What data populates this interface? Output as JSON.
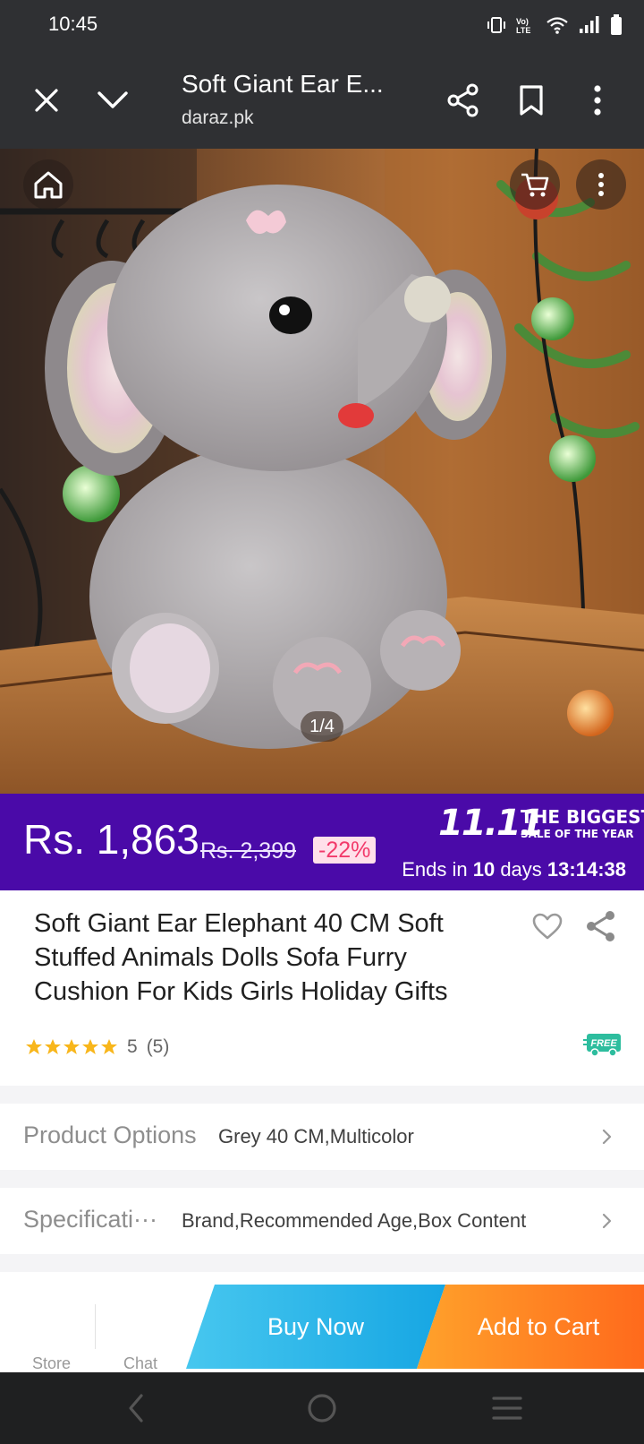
{
  "status_bar": {
    "time": "10:45"
  },
  "toolbar": {
    "title": "Soft Giant Ear E...",
    "url": "daraz.pk"
  },
  "hero": {
    "image_counter": "1/4"
  },
  "price": {
    "current": "Rs. 1,863",
    "original": "Rs. 2,399",
    "discount": "-22%"
  },
  "campaign": {
    "logo_number": "11.11",
    "logo_line1": "THE BIGGEST",
    "logo_line2": "SALE OF THE YEAR",
    "ends_prefix": "Ends in",
    "ends_days": "10",
    "ends_days_label": "days",
    "ends_time": "13:14:38"
  },
  "product": {
    "title": "Soft Giant Ear Elephant 40 CM Soft Stuffed Animals Dolls Sofa Furry Cushion For Kids Girls Holiday Gifts",
    "rating": 5,
    "rating_text": "5",
    "review_count": "(5)",
    "free_shipping_badge": "FREE"
  },
  "options": {
    "product_options_label": "Product Options",
    "product_options_value": "Grey 40 CM,Multicolor",
    "specifications_label": "Specificati···",
    "specifications_value": "Brand,Recommended Age,Box Content"
  },
  "action_bar": {
    "store_label": "Store",
    "chat_label": "Chat",
    "buy_now_label": "Buy Now",
    "add_to_cart_label": "Add to Cart"
  },
  "colors": {
    "banner_purple": "#4a0aa8",
    "discount_pink": "#f23a6b",
    "buy_now_blue": "#16a6e3",
    "add_to_cart_orange": "#ff6a1c",
    "star_yellow": "#f8b61b",
    "free_teal": "#2dbd9e"
  },
  "icons": {
    "close": "close-icon",
    "collapse": "chevron-down-icon",
    "share": "share-icon",
    "bookmark": "bookmark-icon",
    "menu": "more-vertical-icon",
    "home": "home-icon",
    "cart": "cart-icon",
    "wishlist": "heart-icon",
    "nav_back": "back-icon",
    "nav_home": "circle-home-icon",
    "nav_recent": "recent-apps-icon"
  }
}
